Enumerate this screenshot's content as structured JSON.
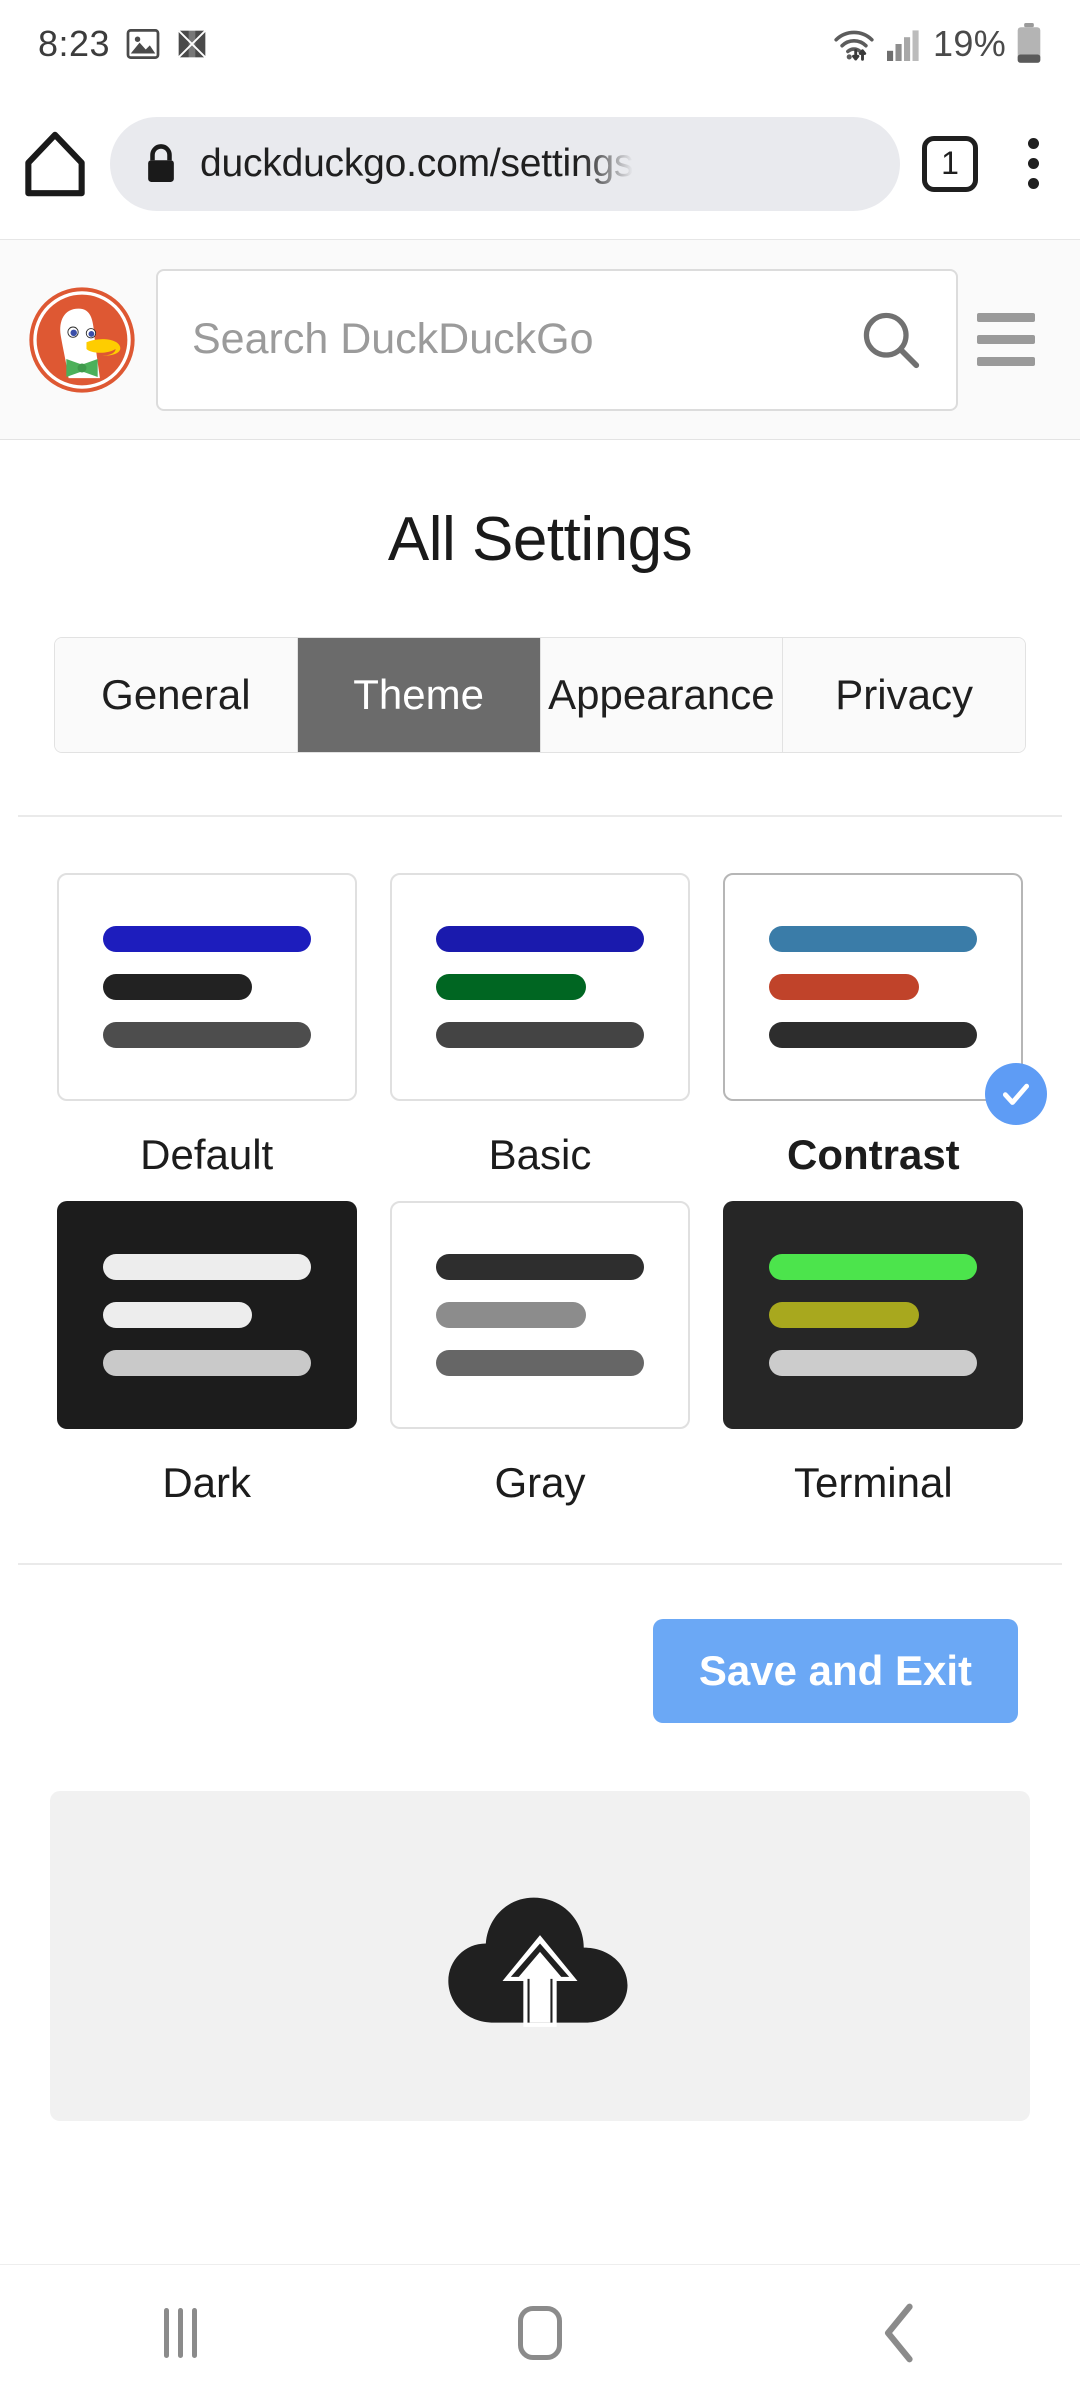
{
  "status_bar": {
    "time": "8:23",
    "battery_percent": "19%",
    "icons": [
      "image-icon",
      "puzzle-icon",
      "wifi-icon",
      "cellular-signal-icon",
      "battery-icon"
    ]
  },
  "browser": {
    "home_icon": "home-icon",
    "lock_icon": "lock-icon",
    "url": "duckduckgo.com/settings",
    "tab_count": "1",
    "menu_icon": "kebab-menu-icon"
  },
  "ddg_header": {
    "logo_icon": "duckduckgo-logo-icon",
    "search_placeholder": "Search DuckDuckGo",
    "search_value": "",
    "search_icon": "search-icon",
    "menu_icon": "hamburger-menu-icon"
  },
  "settings": {
    "title": "All Settings",
    "tabs": [
      {
        "label": "General",
        "active": false
      },
      {
        "label": "Theme",
        "active": true
      },
      {
        "label": "Appearance",
        "active": false
      },
      {
        "label": "Privacy",
        "active": false
      }
    ],
    "themes": [
      {
        "label": "Default",
        "selected": false,
        "card_bg": "#ffffff",
        "card_style": "light",
        "bars": [
          "#1d1dbd",
          "#222222",
          "#4d4d4d"
        ]
      },
      {
        "label": "Basic",
        "selected": false,
        "card_bg": "#ffffff",
        "card_style": "light",
        "bars": [
          "#1a1aad",
          "#006622",
          "#444444"
        ]
      },
      {
        "label": "Contrast",
        "selected": true,
        "card_bg": "#ffffff",
        "card_style": "light",
        "bars": [
          "#3a7ca8",
          "#c0432a",
          "#2d2d2d"
        ]
      },
      {
        "label": "Dark",
        "selected": false,
        "card_bg": "#1c1c1c",
        "card_style": "filled",
        "bars": [
          "#ededed",
          "#ededed",
          "#c9c9c9"
        ]
      },
      {
        "label": "Gray",
        "selected": false,
        "card_bg": "#ffffff",
        "card_style": "light",
        "bars": [
          "#2e2e2e",
          "#8c8c8c",
          "#666666"
        ]
      },
      {
        "label": "Terminal",
        "selected": false,
        "card_bg": "#262626",
        "card_style": "filled",
        "bars": [
          "#4ce44c",
          "#a8a81e",
          "#cccccc"
        ]
      }
    ],
    "selected_badge_icon": "check-circle-icon",
    "save_button": {
      "label": "Save and Exit",
      "color": "#6ba8f5"
    },
    "upload_panel": {
      "icon": "cloud-upload-icon"
    }
  },
  "nav_bar": {
    "recents_icon": "recents-icon",
    "home_icon": "home-square-icon",
    "back_icon": "back-chevron-icon"
  }
}
